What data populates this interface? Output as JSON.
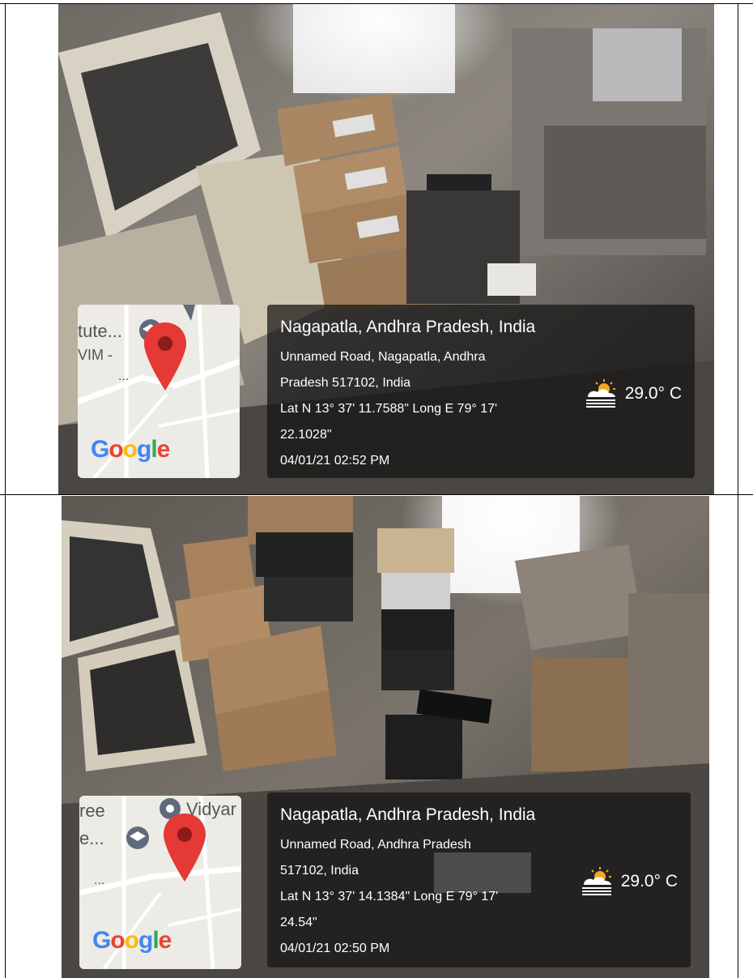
{
  "photos": [
    {
      "map": {
        "labels": [
          "tute...",
          "VIM -",
          "..."
        ],
        "google_logo": "Google"
      },
      "info": {
        "place": "Nagapatla, Andhra Pradesh, India",
        "address_line_1": "Unnamed Road, Nagapatla, Andhra",
        "address_line_2": "Pradesh 517102, India",
        "coords_line_1": "Lat N 13° 37' 11.7588\" Long E 79° 17'",
        "coords_line_2": "22.1028\"",
        "datetime": "04/01/21 02:52 PM",
        "temperature": "29.0° C",
        "weather_icon": "partly-sunny-haze-icon"
      }
    },
    {
      "map": {
        "labels": [
          "ree",
          "e...",
          "Vidyar",
          "..."
        ],
        "google_logo": "Google"
      },
      "info": {
        "place": "Nagapatla, Andhra Pradesh, India",
        "address_line_1": "Unnamed Road, Andhra Pradesh",
        "address_line_2": "517102, India",
        "coords_line_1": "Lat N 13° 37' 14.1384\" Long E 79° 17'",
        "coords_line_2": "24.54\"",
        "datetime": "04/01/21 02:50 PM",
        "temperature": "29.0° C",
        "weather_icon": "partly-sunny-haze-icon"
      }
    }
  ],
  "colors": {
    "pin": "#e53935",
    "google": [
      "#4285F4",
      "#EA4335",
      "#FBBC05",
      "#4285F4",
      "#34A853",
      "#EA4335"
    ]
  }
}
